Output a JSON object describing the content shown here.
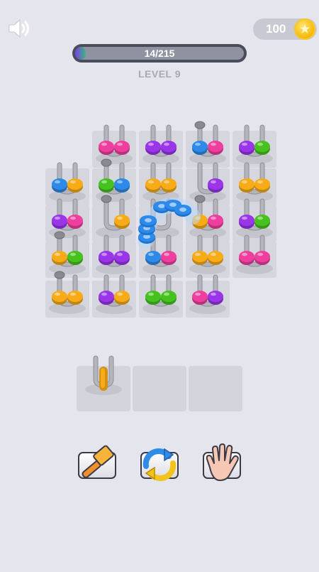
{
  "hud": {
    "coins": "100",
    "progress_text": "14/215",
    "progress_fraction": 0.065,
    "level_label": "LEVEL 9"
  },
  "icons": {
    "sound": "speaker-icon",
    "coin": "coin-icon",
    "hammer": "hammer-icon",
    "shuffle": "shuffle-icon",
    "hand": "hand-icon"
  },
  "colors": {
    "pink": "#ee3f9e",
    "purple": "#9b35ea",
    "blue": "#2d8ae8",
    "orange": "#f7ab17",
    "green": "#46c21f",
    "tile": "#d6d6de",
    "peg": "#b4b4bc"
  },
  "board": {
    "pegs": [
      {
        "row": 0,
        "col": 1,
        "rings": [
          "pink",
          "pink"
        ],
        "knob": false
      },
      {
        "row": 0,
        "col": 2,
        "rings": [
          "purple",
          "purple"
        ],
        "knob": false
      },
      {
        "row": 0,
        "col": 3,
        "rings": [
          "blue",
          "pink"
        ],
        "knob": true
      },
      {
        "row": 0,
        "col": 4,
        "rings": [
          "purple",
          "green"
        ],
        "knob": false
      },
      {
        "row": 1,
        "col": 0,
        "rings": [
          "blue",
          "orange"
        ],
        "knob": false
      },
      {
        "row": 1,
        "col": 1,
        "rings": [
          "green",
          "blue"
        ],
        "knob": true
      },
      {
        "row": 1,
        "col": 2,
        "rings": [
          "orange",
          "orange"
        ],
        "knob": false
      },
      {
        "row": 1,
        "col": 3,
        "rings": [
          "",
          "purple"
        ],
        "knob": false
      },
      {
        "row": 1,
        "col": 4,
        "rings": [
          "orange",
          "orange"
        ],
        "knob": false
      },
      {
        "row": 2,
        "col": 0,
        "rings": [
          "purple",
          "pink"
        ],
        "knob": false
      },
      {
        "row": 2,
        "col": 1,
        "rings": [
          "",
          "orange"
        ],
        "knob": true
      },
      {
        "row": 2,
        "col": 2,
        "rings": [
          "",
          ""
        ],
        "knob": false
      },
      {
        "row": 2,
        "col": 3,
        "rings": [
          "orange",
          "pink"
        ],
        "knob": true
      },
      {
        "row": 2,
        "col": 4,
        "rings": [
          "purple",
          "green"
        ],
        "knob": false
      },
      {
        "row": 3,
        "col": 0,
        "rings": [
          "orange",
          "green"
        ],
        "knob": true
      },
      {
        "row": 3,
        "col": 1,
        "rings": [
          "purple",
          "purple"
        ],
        "knob": false
      },
      {
        "row": 3,
        "col": 2,
        "rings": [
          "blue",
          "pink"
        ],
        "knob": false
      },
      {
        "row": 3,
        "col": 3,
        "rings": [
          "orange",
          "orange"
        ],
        "knob": false
      },
      {
        "row": 3,
        "col": 4,
        "rings": [
          "pink",
          "pink"
        ],
        "knob": false
      },
      {
        "row": 4,
        "col": 0,
        "rings": [
          "orange",
          "orange"
        ],
        "knob": true
      },
      {
        "row": 4,
        "col": 1,
        "rings": [
          "purple",
          "orange"
        ],
        "knob": false
      },
      {
        "row": 4,
        "col": 2,
        "rings": [
          "green",
          "green"
        ],
        "knob": false
      },
      {
        "row": 4,
        "col": 3,
        "rings": [
          "pink",
          "purple"
        ],
        "knob": false
      }
    ]
  },
  "tray": {
    "slots": [
      {
        "ring": "orange"
      },
      {
        "ring": ""
      },
      {
        "ring": ""
      }
    ]
  },
  "boosters": [
    {
      "name": "hammer"
    },
    {
      "name": "shuffle"
    },
    {
      "name": "hand"
    }
  ]
}
